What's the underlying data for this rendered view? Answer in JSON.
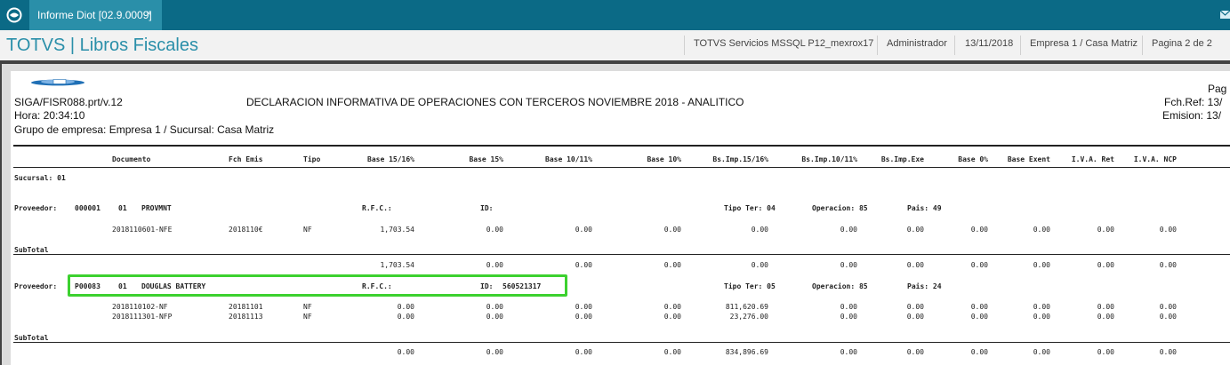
{
  "tab": {
    "title": "Informe Diot [02.9.0009]",
    "close": "×"
  },
  "header": {
    "title": "TOTVS | Libros Fiscales",
    "server": "TOTVS Servicios MSSQL P12_mexrox17",
    "user": "Administrador",
    "date": "13/11/2018",
    "company": "Empresa 1 / Casa Matriz",
    "page": "Pagina 2 de 2"
  },
  "report": {
    "program": "SIGA/FISR088.prt/v.12",
    "title": "DECLARACION INFORMATIVA DE OPERACIONES CON TERCEROS NOVIEMBRE 2018  - ANALITICO",
    "time": "Hora: 20:34:10",
    "group": "Grupo de empresa: Empresa 1 / Sucursal: Casa Matriz",
    "page_label": "Pag",
    "fch_ref": "Fch.Ref: 13/",
    "emision": "Emision: 13/",
    "columns": [
      "Documento",
      "Fch Emis",
      "Tipo",
      "Base 15/16%",
      "Base 15%",
      "Base 10/11%",
      "Base 10%",
      "Bs.Imp.15/16%",
      "Bs.Imp.10/11%",
      "Bs.Imp.Exe",
      "Base 0%",
      "Base Exent",
      "I.V.A. Ret",
      "I.V.A. NCP"
    ],
    "sucursal": "Sucursal: 01",
    "subtotal_label": "SubTotal",
    "providers": [
      {
        "label": "Proveedor:",
        "code": "000001",
        "store": "01",
        "name": "PROVMNT",
        "rfc_label": "R.F.C.:",
        "id_label": "ID:",
        "id": "",
        "tipo_ter": "Tipo Ter: 04",
        "operacion": "Operacion: 85",
        "pais": "Pais: 49",
        "rows": [
          [
            "2018110601-NFE",
            "2018110€",
            "NF",
            "1,703.54",
            "0.00",
            "0.00",
            "0.00",
            "0.00",
            "0.00",
            "0.00",
            "0.00",
            "0.00",
            "0.00",
            "0.00"
          ]
        ],
        "subtotal": [
          "1,703.54",
          "0.00",
          "0.00",
          "0.00",
          "0.00",
          "0.00",
          "0.00",
          "0.00",
          "0.00",
          "0.00",
          "0.00"
        ]
      },
      {
        "label": "Proveedor:",
        "code": "P00083",
        "store": "01",
        "name": "DOUGLAS BATTERY",
        "rfc_label": "R.F.C.:",
        "id_label": "ID:",
        "id": "560521317",
        "tipo_ter": "Tipo Ter: 05",
        "operacion": "Operacion: 85",
        "pais": "Pais: 24",
        "rows": [
          [
            "2018110102-NF",
            "20181101",
            "NF",
            "0.00",
            "0.00",
            "0.00",
            "0.00",
            "811,620.69",
            "0.00",
            "0.00",
            "0.00",
            "0.00",
            "0.00",
            "0.00"
          ],
          [
            "2018111301-NFP",
            "20181113",
            "NF",
            "0.00",
            "0.00",
            "0.00",
            "0.00",
            "23,276.00",
            "0.00",
            "0.00",
            "0.00",
            "0.00",
            "0.00",
            "0.00"
          ]
        ],
        "subtotal": [
          "0.00",
          "0.00",
          "0.00",
          "0.00",
          "834,896.69",
          "0.00",
          "0.00",
          "0.00",
          "0.00",
          "0.00",
          "0.00"
        ]
      }
    ]
  },
  "colors": {
    "topbar": "#0b6a86",
    "tab": "#2a8fa9",
    "title": "#2a8fa9",
    "highlight": "#3cd12f"
  },
  "icons": {
    "app": "totvs-logo-icon",
    "mail": "mail-icon",
    "report_logo": "report-logo-icon"
  }
}
